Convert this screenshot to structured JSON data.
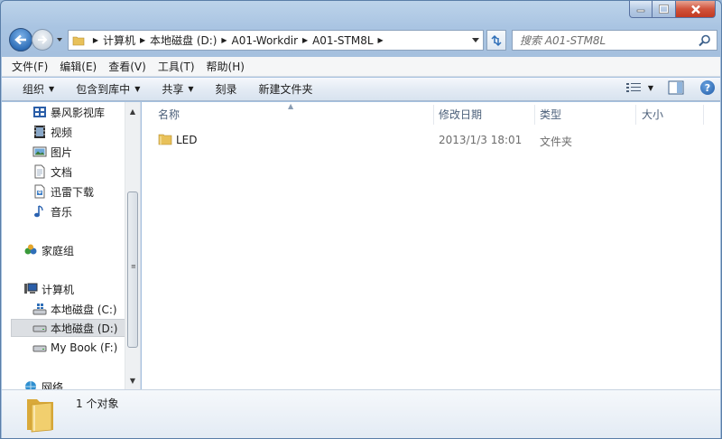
{
  "window": {
    "caption_buttons": [
      "minimize-icon",
      "maximize-icon",
      "close-icon"
    ]
  },
  "address": {
    "crumbs": [
      "计算机",
      "本地磁盘 (D:)",
      "A01-Workdir",
      "A01-STM8L"
    ]
  },
  "search": {
    "placeholder": "搜索 A01-STM8L"
  },
  "menu": {
    "items": [
      "文件(F)",
      "编辑(E)",
      "查看(V)",
      "工具(T)",
      "帮助(H)"
    ]
  },
  "toolbar": {
    "organize": "组织",
    "include_in_library": "包含到库中",
    "share": "共享",
    "burn": "刻录",
    "new_folder": "新建文件夹"
  },
  "nav": {
    "items": [
      {
        "label": "暴风影视库",
        "icon": "video-library-icon"
      },
      {
        "label": "视频",
        "icon": "video-icon"
      },
      {
        "label": "图片",
        "icon": "pictures-icon"
      },
      {
        "label": "文档",
        "icon": "documents-icon"
      },
      {
        "label": "迅雷下载",
        "icon": "downloads-icon"
      },
      {
        "label": "音乐",
        "icon": "music-icon"
      },
      {
        "label": "家庭组",
        "icon": "homegroup-icon"
      },
      {
        "label": "计算机",
        "icon": "computer-icon"
      },
      {
        "label": "本地磁盘 (C:)",
        "icon": "system-drive-icon"
      },
      {
        "label": "本地磁盘 (D:)",
        "icon": "drive-icon",
        "selected": true
      },
      {
        "label": "My Book (F:)",
        "icon": "drive-icon"
      },
      {
        "label": "网络",
        "icon": "network-icon"
      }
    ]
  },
  "columns": [
    "名称",
    "修改日期",
    "类型",
    "大小"
  ],
  "files": [
    {
      "name": "LED",
      "modified": "2013/1/3 18:01",
      "type": "文件夹",
      "size": ""
    }
  ],
  "status": {
    "summary": "1 个对象"
  },
  "colors": {
    "accent": "#2f6fb8",
    "selection": "#dcdfe3",
    "folder": "#e8c15a"
  }
}
